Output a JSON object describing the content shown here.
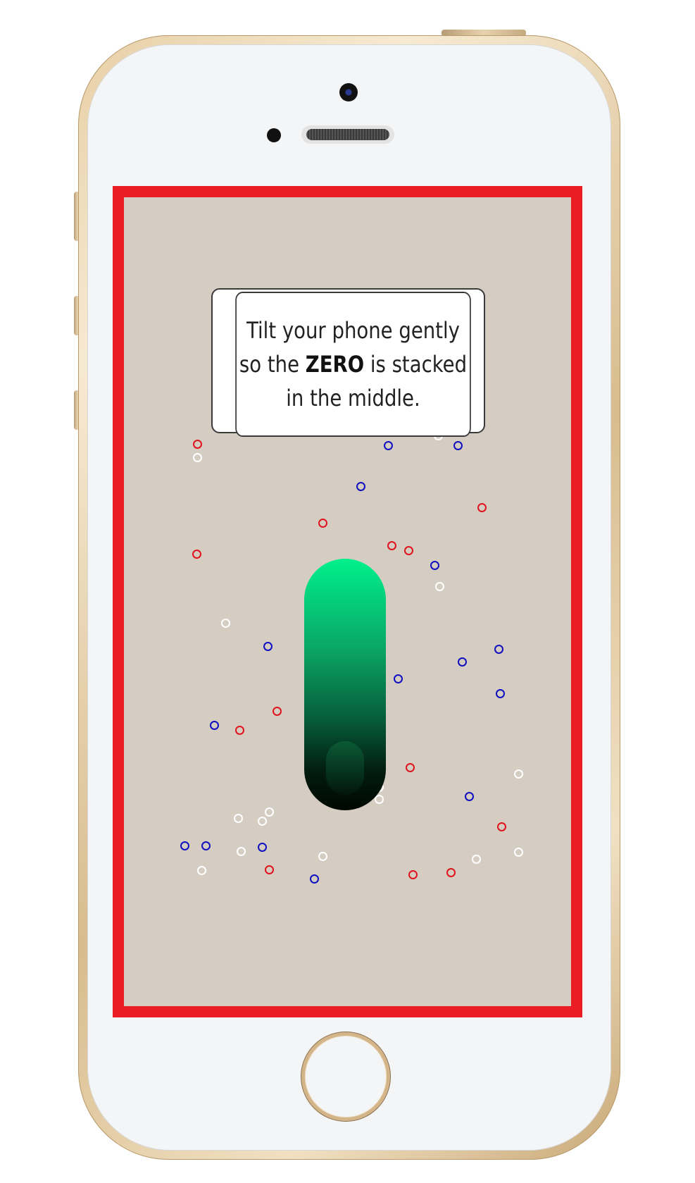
{
  "instruction": {
    "line1": "Tilt your phone gently",
    "line2_before": "so the ",
    "line2_bold": "ZERO",
    "line2_after": " is stacked",
    "line3": "in the middle."
  },
  "colors": {
    "screen_border": "#ec1c24",
    "screen_background": "#d5ccc2",
    "capsule_top": "#00f08c",
    "capsule_bottom": "#000800",
    "dot_red": "#e0141e",
    "dot_blue": "#1010c0",
    "dot_white": "#ffffff"
  },
  "icons": [
    "camera-icon",
    "speaker-grille-icon",
    "home-button-icon"
  ]
}
